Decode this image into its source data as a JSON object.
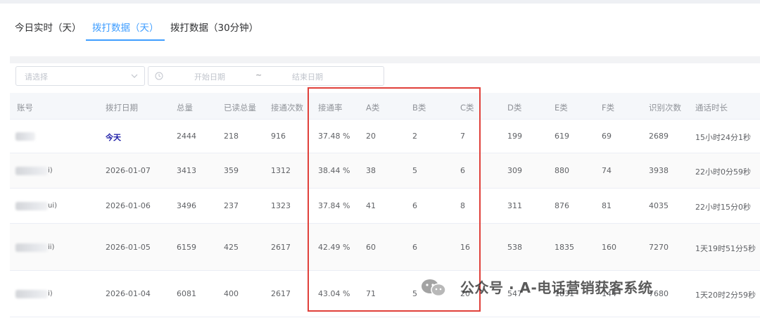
{
  "tabs": [
    {
      "label": "今日实时（天）",
      "active": false
    },
    {
      "label": "拨打数据（天）",
      "active": true
    },
    {
      "label": "拨打数据（30分钟）",
      "active": false
    }
  ],
  "filters": {
    "select_placeholder": "请选择",
    "start_placeholder": "开始日期",
    "separator": "~",
    "end_placeholder": "结束日期"
  },
  "table": {
    "headers": [
      "账号",
      "拨打日期",
      "总量",
      "已读总量",
      "接通次数",
      "接通率",
      "A类",
      "B类",
      "C类",
      "D类",
      "E类",
      "F类",
      "识别次数",
      "通话时长"
    ],
    "rows": [
      {
        "account_suffix": "",
        "date": "今天",
        "total": "2444",
        "read": "218",
        "connected": "916",
        "rate": "37.48 %",
        "a": "20",
        "b": "2",
        "c": "7",
        "d": "199",
        "e": "619",
        "f": "69",
        "recognized": "2689",
        "duration": "15小时24分1秒"
      },
      {
        "account_suffix": "i)",
        "date": "2026-01-07",
        "total": "3413",
        "read": "359",
        "connected": "1312",
        "rate": "38.44 %",
        "a": "38",
        "b": "5",
        "c": "6",
        "d": "309",
        "e": "880",
        "f": "74",
        "recognized": "3938",
        "duration": "22小时0分59秒"
      },
      {
        "account_suffix": "ui)",
        "date": "2026-01-06",
        "total": "3496",
        "read": "237",
        "connected": "1323",
        "rate": "37.84 %",
        "a": "41",
        "b": "6",
        "c": "8",
        "d": "311",
        "e": "876",
        "f": "81",
        "recognized": "4035",
        "duration": "22小时15分0秒"
      },
      {
        "account_suffix": "ii)",
        "date": "2026-01-05",
        "total": "6159",
        "read": "425",
        "connected": "2617",
        "rate": "42.49 %",
        "a": "60",
        "b": "6",
        "c": "16",
        "d": "538",
        "e": "1835",
        "f": "160",
        "recognized": "7270",
        "duration": "1天19时51分5秒"
      },
      {
        "account_suffix": "i)",
        "date": "2026-01-04",
        "total": "6081",
        "read": "400",
        "connected": "2617",
        "rate": "43.04 %",
        "a": "71",
        "b": "5",
        "c": "20",
        "d": "547",
        "e": "1831",
        "f": "144",
        "recognized": "7680",
        "duration": "1天20时2分59秒"
      }
    ]
  },
  "watermark": {
    "text": "公众号 · A-电话营销获客系统",
    "icon": "wechat-icon"
  },
  "colors": {
    "accent": "#409eff",
    "highlight_border": "#e0403a",
    "today_text": "#1a1aa6"
  }
}
